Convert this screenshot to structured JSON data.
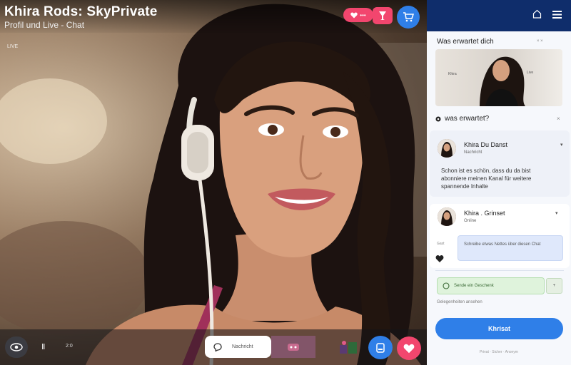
{
  "stage": {
    "title": "Khira Rods: SkyPrivate",
    "subtitle": "Profil und Live - Chat",
    "tag": "LIVE",
    "pill_label": "•••",
    "ctrl_mini_icon": "Ⅱ",
    "ctrl_mini_text": "2:0",
    "chat_input_label": "Nachricht",
    "icons": [
      "heart-icon",
      "glass-icon",
      "cart-icon",
      "eye-icon",
      "chat-icon",
      "emoji-icon",
      "gift-icon",
      "heart-icon"
    ]
  },
  "side": {
    "wait_label": "Was erwartet dich",
    "wait_close": "× ×",
    "preview_left_label": "Khira",
    "preview_right_label": "Live",
    "question": "was erwartet?",
    "question_close": "×",
    "card1": {
      "name": "Khira Du Danst",
      "sub": "Nachricht",
      "chevron": "▾",
      "message_lines": [
        "Schon ist es schön, dass du da bist",
        "abonniere meinen Kanal für weitere",
        "spannende Inhalte"
      ]
    },
    "card2": {
      "name": "Khira . Grinset",
      "sub": "Online",
      "chevron": "▾",
      "side_note": "Gast",
      "field_text": "Schreibe etwas Nettes über diesen Chat"
    },
    "green_field_text": "Sende ein Geschenk",
    "green_mini": "+",
    "note": "Gelegenheiten ansehen",
    "cta_label": "Khrisat",
    "footer": "Privat · Sicher · Anonym"
  },
  "colors": {
    "accent_pink": "#f2466e",
    "accent_blue": "#2f7fe8",
    "panel_header": "#0f2d6b"
  }
}
